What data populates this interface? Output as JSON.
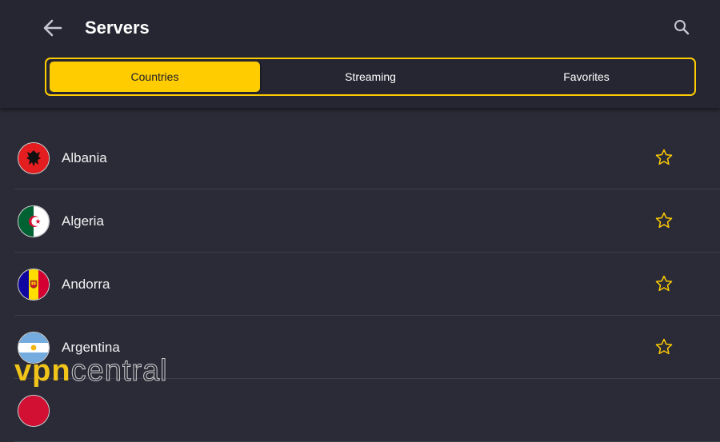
{
  "header": {
    "title": "Servers",
    "back_icon": "arrow-left-icon",
    "search_icon": "search-icon"
  },
  "tabs": [
    {
      "label": "Countries",
      "active": true
    },
    {
      "label": "Streaming",
      "active": false
    },
    {
      "label": "Favorites",
      "active": false
    }
  ],
  "countries": [
    {
      "name": "Albania",
      "flag": "albania-flag-icon",
      "favorite": false
    },
    {
      "name": "Algeria",
      "flag": "algeria-flag-icon",
      "favorite": false
    },
    {
      "name": "Andorra",
      "flag": "andorra-flag-icon",
      "favorite": false
    },
    {
      "name": "Argentina",
      "flag": "argentina-flag-icon",
      "favorite": false
    }
  ],
  "watermark": {
    "part1": "vpn",
    "part2": "central"
  },
  "colors": {
    "accent": "#ffcc00",
    "background": "#2a2b37",
    "header": "#252632",
    "divider": "#3e3f4c"
  }
}
